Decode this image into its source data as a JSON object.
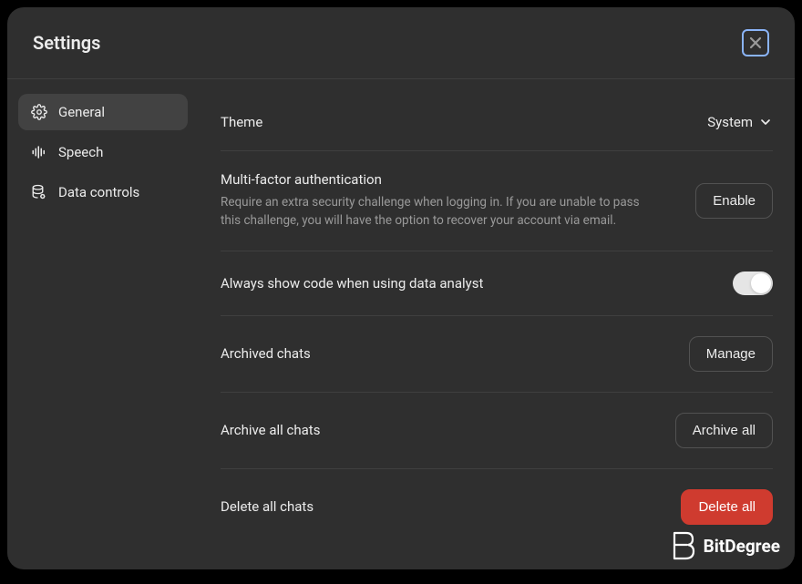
{
  "header": {
    "title": "Settings"
  },
  "sidebar": {
    "items": [
      {
        "label": "General"
      },
      {
        "label": "Speech"
      },
      {
        "label": "Data controls"
      }
    ]
  },
  "main": {
    "theme": {
      "label": "Theme",
      "value": "System"
    },
    "mfa": {
      "label": "Multi-factor authentication",
      "description": "Require an extra security challenge when logging in. If you are unable to pass this challenge, you will have the option to recover your account via email.",
      "button": "Enable"
    },
    "alwaysCode": {
      "label": "Always show code when using data analyst"
    },
    "archived": {
      "label": "Archived chats",
      "button": "Manage"
    },
    "archiveAll": {
      "label": "Archive all chats",
      "button": "Archive all"
    },
    "deleteAll": {
      "label": "Delete all chats",
      "button": "Delete all"
    }
  },
  "watermark": {
    "text": "BitDegree"
  }
}
